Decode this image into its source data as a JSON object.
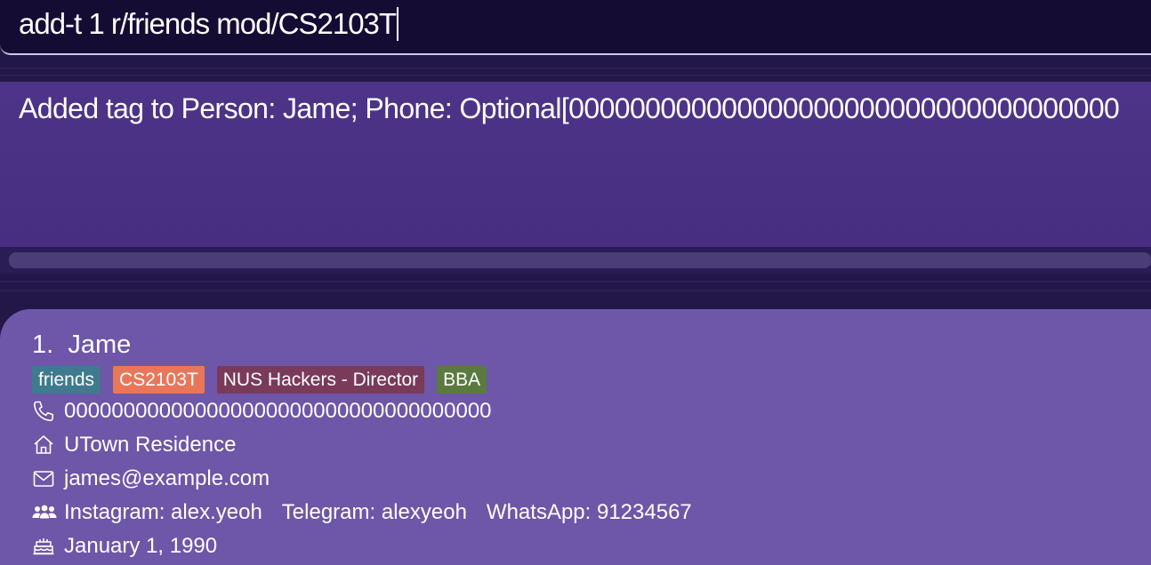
{
  "command_box": {
    "value": "add-t 1 r/friends mod/CS2103T"
  },
  "result_display": {
    "text": "Added tag to Person: Jame; Phone: Optional[000000000000000000000000000000000000"
  },
  "person_card": {
    "index": "1.",
    "name": "Jame",
    "tags": [
      {
        "label": "friends",
        "color": "#3f7a8f"
      },
      {
        "label": "CS2103T",
        "color": "#e8775a"
      },
      {
        "label": "NUS Hackers - Director",
        "color": "#7a3a5a"
      },
      {
        "label": "BBA",
        "color": "#5b7a3f"
      }
    ],
    "phone": "000000000000000000000000000000000000",
    "address": "UTown Residence",
    "email": "james@example.com",
    "socials": {
      "instagram": "Instagram: alex.yeoh",
      "telegram": "Telegram: alexyeoh",
      "whatsapp": "WhatsApp: 91234567"
    },
    "birthday": "January 1, 1990",
    "icons": {
      "phone": "phone-icon",
      "address": "home-icon",
      "email": "envelope-icon",
      "socials": "people-icon",
      "birthday": "cake-icon"
    }
  },
  "colors": {
    "command_bg": "#150c33",
    "result_bg": "#4e3488",
    "card_bg": "#6e56a8"
  }
}
